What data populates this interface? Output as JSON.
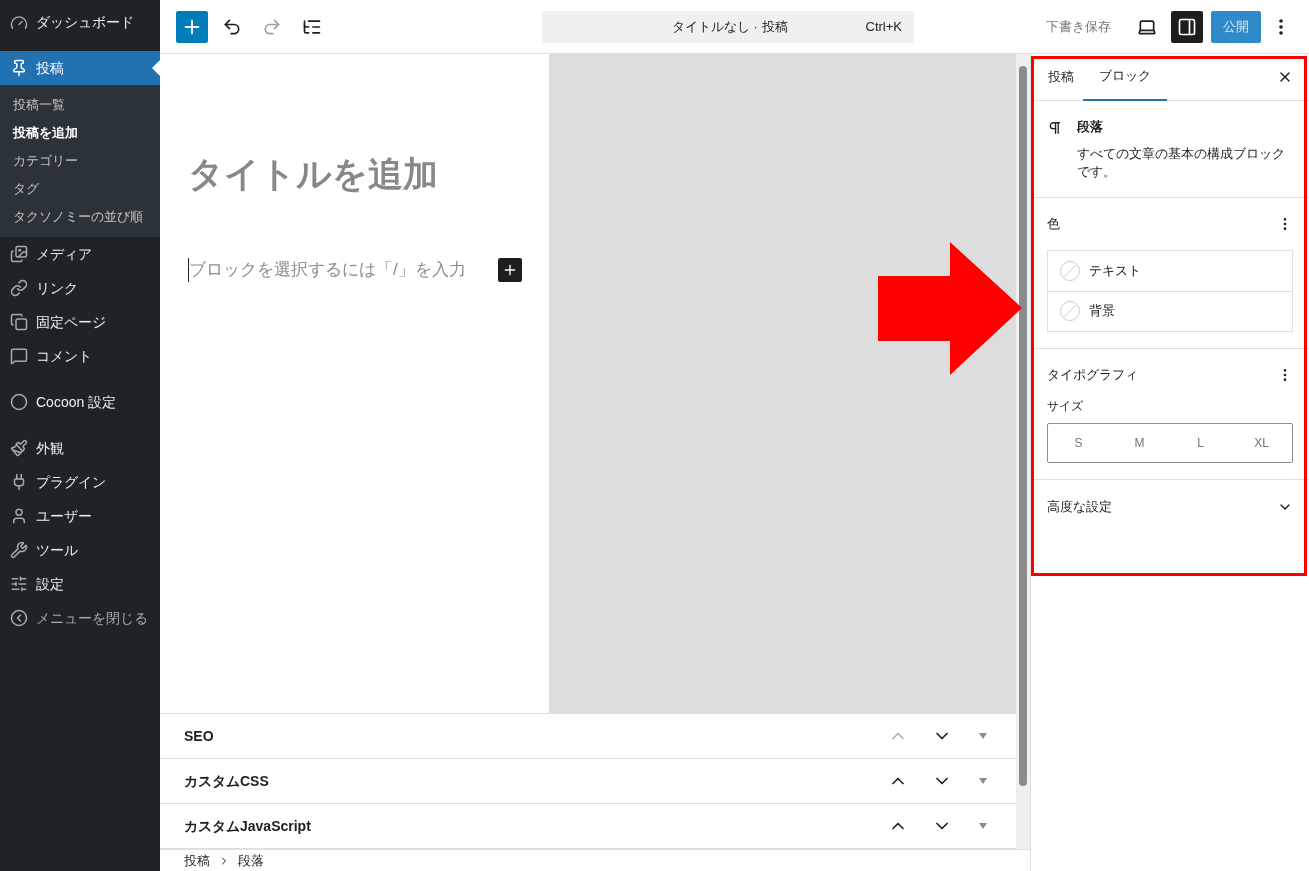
{
  "sidebar": {
    "items": [
      {
        "label": "ダッシュボード",
        "selected": false
      },
      {
        "label": "投稿",
        "selected": true,
        "children": [
          {
            "label": "投稿一覧",
            "selected": false
          },
          {
            "label": "投稿を追加",
            "selected": true
          },
          {
            "label": "カテゴリー",
            "selected": false
          },
          {
            "label": "タグ",
            "selected": false
          },
          {
            "label": "タクソノミーの並び順",
            "selected": false
          }
        ]
      },
      {
        "label": "メディア",
        "selected": false
      },
      {
        "label": "リンク",
        "selected": false
      },
      {
        "label": "固定ページ",
        "selected": false
      },
      {
        "label": "コメント",
        "selected": false
      },
      {
        "label": "Cocoon 設定",
        "selected": false
      },
      {
        "label": "外観",
        "selected": false
      },
      {
        "label": "プラグイン",
        "selected": false
      },
      {
        "label": "ユーザー",
        "selected": false
      },
      {
        "label": "ツール",
        "selected": false
      },
      {
        "label": "設定",
        "selected": false
      }
    ],
    "collapse": "メニューを閉じる"
  },
  "toolbar": {
    "redo_disabled": true,
    "command_title": "タイトルなし · 投稿",
    "command_shortcut": "Ctrl+K",
    "save_draft": "下書き保存",
    "settings_pressed": true,
    "publish": "公開"
  },
  "editor": {
    "title_placeholder": "タイトルを追加",
    "paragraph_placeholder": "ブロックを選択するには「/」を入力"
  },
  "meta_boxes": [
    {
      "title": "SEO",
      "up_disabled": true
    },
    {
      "title": "カスタムCSS",
      "up_disabled": false
    },
    {
      "title": "カスタムJavaScript",
      "up_disabled": false
    }
  ],
  "breadcrumb": [
    "投稿",
    "段落"
  ],
  "settings_panel": {
    "tabs": [
      {
        "label": "投稿",
        "selected": false
      },
      {
        "label": "ブロック",
        "selected": true
      }
    ],
    "block": {
      "name": "段落",
      "description": "すべての文章の基本の構成ブロックです。"
    },
    "color": {
      "title": "色",
      "items": [
        "テキスト",
        "背景"
      ]
    },
    "typography": {
      "title": "タイポグラフィ",
      "size_label": "サイズ",
      "sizes": [
        {
          "label": "S",
          "selected": false
        },
        {
          "label": "M",
          "selected": false
        },
        {
          "label": "L",
          "selected": false
        },
        {
          "label": "XL",
          "selected": false
        }
      ]
    },
    "advanced": {
      "title": "高度な設定",
      "expanded": false
    }
  }
}
